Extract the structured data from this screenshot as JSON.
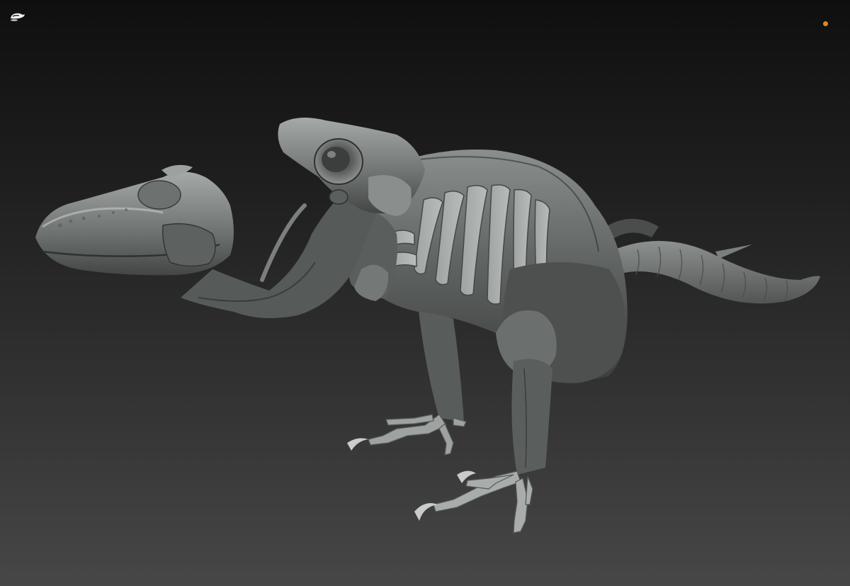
{
  "app": {
    "logo_icon": "zbrush-brush-logo-icon",
    "status_indicator_color": "#e8832a"
  },
  "viewport": {
    "background_top": "#0f0f0f",
    "background_bottom": "#474747",
    "model_material": "matcap-gray-clay"
  }
}
